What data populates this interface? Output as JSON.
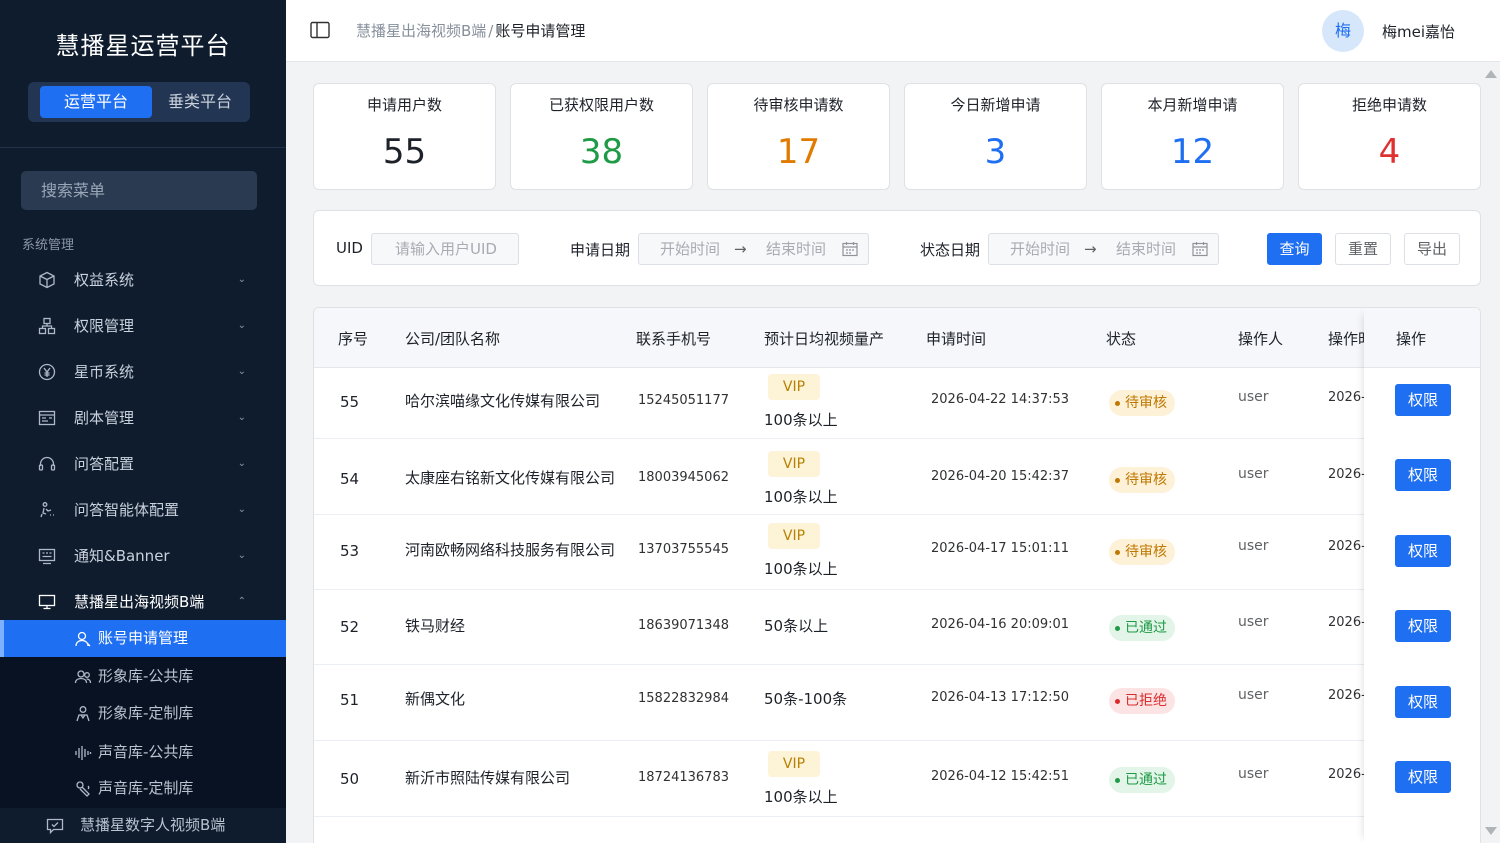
{
  "sidebar": {
    "title": "慧播星运营平台",
    "platform_tabs": [
      "运营平台",
      "垂类平台"
    ],
    "search_placeholder": "搜索菜单",
    "section_label": "系统管理",
    "menu": [
      {
        "label": "权益系统",
        "icon": "cube-icon"
      },
      {
        "label": "权限管理",
        "icon": "org-tree-icon"
      },
      {
        "label": "星币系统",
        "icon": "yen-coin-icon"
      },
      {
        "label": "剧本管理",
        "icon": "script-board-icon"
      },
      {
        "label": "问答配置",
        "icon": "headset-icon"
      },
      {
        "label": "问答智能体配置",
        "icon": "agent-icon"
      },
      {
        "label": "通知&Banner",
        "icon": "notice-board-icon"
      },
      {
        "label": "慧播星出海视频B端",
        "icon": "monitor-icon"
      }
    ],
    "submenu": [
      {
        "label": "账号申请管理",
        "icon": "user-icon"
      },
      {
        "label": "形象库-公共库",
        "icon": "users-icon"
      },
      {
        "label": "形象库-定制库",
        "icon": "user-group-icon"
      },
      {
        "label": "声音库-公共库",
        "icon": "waveform-icon"
      },
      {
        "label": "声音库-定制库",
        "icon": "voice-edit-icon"
      }
    ],
    "bottom_item": {
      "label": "慧播星数字人视频B端",
      "icon": "chat-screen-icon"
    }
  },
  "header": {
    "breadcrumb_parent": "慧播星出海视频B端",
    "breadcrumb_sep": "/",
    "breadcrumb_current": "账号申请管理",
    "avatar_text": "梅",
    "username": "梅mei嘉怡"
  },
  "stats": [
    {
      "label": "申请用户数",
      "value": "55",
      "color": "#1d2129"
    },
    {
      "label": "已获权限用户数",
      "value": "38",
      "color": "#1f9a46"
    },
    {
      "label": "待审核申请数",
      "value": "17",
      "color": "#e07b00"
    },
    {
      "label": "今日新增申请",
      "value": "3",
      "color": "#1f6ff2"
    },
    {
      "label": "本月新增申请",
      "value": "12",
      "color": "#1f6ff2"
    },
    {
      "label": "拒绝申请数",
      "value": "4",
      "color": "#e03131"
    }
  ],
  "filter": {
    "uid_label": "UID",
    "uid_placeholder": "请输入用户UID",
    "apply_date_label": "申请日期",
    "status_date_label": "状态日期",
    "start_placeholder": "开始时间",
    "end_placeholder": "结束时间",
    "arrow": "→",
    "query": "查询",
    "reset": "重置",
    "export": "导出"
  },
  "table": {
    "headers": [
      "序号",
      "公司/团队名称",
      "联系手机号",
      "预计日均视频量产",
      "申请时间",
      "状态",
      "操作人",
      "操作时间",
      "操作"
    ],
    "rows": [
      {
        "no": "55",
        "company": "哈尔滨喵缘文化传媒有限公司",
        "phone": "15245051177",
        "vip": "VIP",
        "volume": "100条以上",
        "time": "2026-04-22 14:37:53",
        "status": "待审核",
        "status_type": "pending",
        "operator": "user",
        "op_time": "2026-",
        "action": "权限"
      },
      {
        "no": "54",
        "company": "太康座右铭新文化传媒有限公司",
        "phone": "18003945062",
        "vip": "VIP",
        "volume": "100条以上",
        "time": "2026-04-20 15:42:37",
        "status": "待审核",
        "status_type": "pending",
        "operator": "user",
        "op_time": "2026-",
        "action": "权限"
      },
      {
        "no": "53",
        "company": "河南欧畅网络科技服务有限公司",
        "phone": "13703755545",
        "vip": "VIP",
        "volume": "100条以上",
        "time": "2026-04-17 15:01:11",
        "status": "待审核",
        "status_type": "pending",
        "operator": "user",
        "op_time": "2026-",
        "action": "权限"
      },
      {
        "no": "52",
        "company": "铁马财经",
        "phone": "18639071348",
        "vip": "",
        "volume": "50条以上",
        "time": "2026-04-16 20:09:01",
        "status": "已通过",
        "status_type": "pass",
        "operator": "user",
        "op_time": "2026-",
        "action": "权限"
      },
      {
        "no": "51",
        "company": "新偶文化",
        "phone": "15822832984",
        "vip": "",
        "volume": "50条-100条",
        "time": "2026-04-13 17:12:50",
        "status": "已拒绝",
        "status_type": "reject",
        "operator": "user",
        "op_time": "2026-",
        "action": "权限"
      },
      {
        "no": "50",
        "company": "新沂市照陆传媒有限公司",
        "phone": "18724136783",
        "vip": "VIP",
        "volume": "100条以上",
        "time": "2026-04-12 15:42:51",
        "status": "已通过",
        "status_type": "pass",
        "operator": "user",
        "op_time": "2026-",
        "action": "权限"
      }
    ]
  }
}
